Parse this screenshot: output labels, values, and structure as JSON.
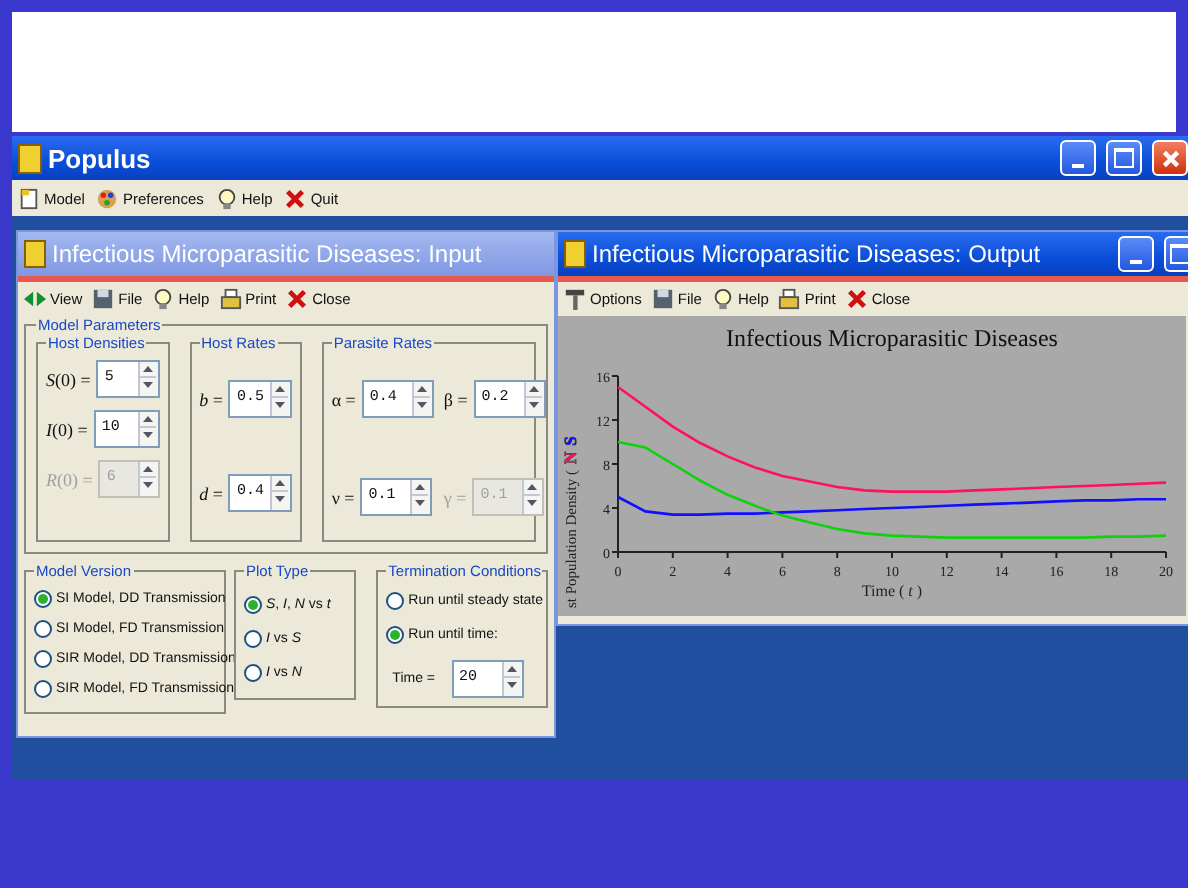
{
  "app": {
    "title": "Populus",
    "menu": [
      "Model",
      "Preferences",
      "Help",
      "Quit"
    ]
  },
  "input_window": {
    "title": "Infectious Microparasitic Diseases: Input",
    "active": false,
    "toolbar": [
      "View",
      "File",
      "Help",
      "Print",
      "Close"
    ],
    "model_parameters": {
      "label": "Model Parameters",
      "groups": [
        {
          "label": "Host Densities",
          "fields": [
            {
              "label": "*S*(0) =",
              "value": "5",
              "disabled": false
            },
            {
              "label": "*I*(0) =",
              "value": "10",
              "disabled": false
            },
            {
              "label": "*R*(0) =",
              "value": "6",
              "disabled": true
            }
          ]
        },
        {
          "label": "Host Rates",
          "fields": [
            {
              "label": "*b* =",
              "value": "0.5",
              "disabled": false
            },
            {
              "label": "*d* =",
              "value": "0.4",
              "disabled": false
            }
          ]
        },
        {
          "label": "Parasite Rates",
          "fields": [
            {
              "label": "α =",
              "value": "0.4",
              "disabled": false
            },
            {
              "label": "β =",
              "value": "0.2",
              "disabled": false
            },
            {
              "label": "ν =",
              "value": "0.1",
              "disabled": false
            },
            {
              "label": "γ =",
              "value": "0.1",
              "disabled": true
            }
          ]
        }
      ]
    },
    "model_version": {
      "label": "Model Version",
      "options": [
        {
          "label": "SI Model, DD Transmission",
          "selected": true
        },
        {
          "label": "SI Model, FD Transmission",
          "selected": false
        },
        {
          "label": "SIR Model, DD Transmission",
          "selected": false
        },
        {
          "label": "SIR Model, FD Transmission",
          "selected": false
        }
      ]
    },
    "plot_type": {
      "label": "Plot Type",
      "options": [
        {
          "label": "*S*, *I*, *N* vs *t*",
          "selected": true
        },
        {
          "label": "*I* vs *S*",
          "selected": false
        },
        {
          "label": "*I* vs *N*",
          "selected": false
        }
      ]
    },
    "termination": {
      "label": "Termination Conditions",
      "options": [
        {
          "label": "Run until steady state",
          "selected": false
        },
        {
          "label": "Run until time:",
          "selected": true
        }
      ],
      "time": {
        "label": "Time =",
        "value": "20"
      }
    }
  },
  "output_window": {
    "title": "Infectious Microparasitic Diseases: Output",
    "active": true,
    "toolbar": [
      "Options",
      "File",
      "Help",
      "Print",
      "Close"
    ],
    "chart_data": {
      "type": "line",
      "title": "Infectious Microparasitic Diseases",
      "xlabel": "Time ( *t* )",
      "ylabel": "st Population Density (",
      "x": [
        0,
        1,
        2,
        3,
        4,
        5,
        6,
        7,
        8,
        9,
        10,
        11,
        12,
        13,
        14,
        15,
        16,
        17,
        18,
        19,
        20
      ],
      "series": [
        {
          "name": "N",
          "color": "#ff1060",
          "values": [
            15,
            13.2,
            11.4,
            9.9,
            8.7,
            7.7,
            6.9,
            6.4,
            5.9,
            5.6,
            5.5,
            5.5,
            5.5,
            5.6,
            5.7,
            5.8,
            5.9,
            6.0,
            6.1,
            6.2,
            6.3
          ]
        },
        {
          "name": "S",
          "color": "#1010ff",
          "values": [
            5,
            3.7,
            3.4,
            3.4,
            3.5,
            3.5,
            3.6,
            3.7,
            3.8,
            3.9,
            4.0,
            4.1,
            4.2,
            4.3,
            4.4,
            4.5,
            4.6,
            4.7,
            4.7,
            4.8,
            4.8
          ]
        },
        {
          "color": "#10d010",
          "values": [
            10,
            9.5,
            8.0,
            6.5,
            5.2,
            4.2,
            3.3,
            2.7,
            2.1,
            1.7,
            1.5,
            1.4,
            1.3,
            1.3,
            1.3,
            1.3,
            1.3,
            1.3,
            1.4,
            1.4,
            1.5
          ]
        }
      ],
      "xlim": [
        0,
        20
      ],
      "ylim": [
        0,
        16
      ],
      "xticks": [
        0,
        2,
        4,
        6,
        8,
        10,
        12,
        14,
        16,
        18,
        20
      ],
      "yticks": [
        0,
        4,
        8,
        12,
        16
      ]
    }
  }
}
